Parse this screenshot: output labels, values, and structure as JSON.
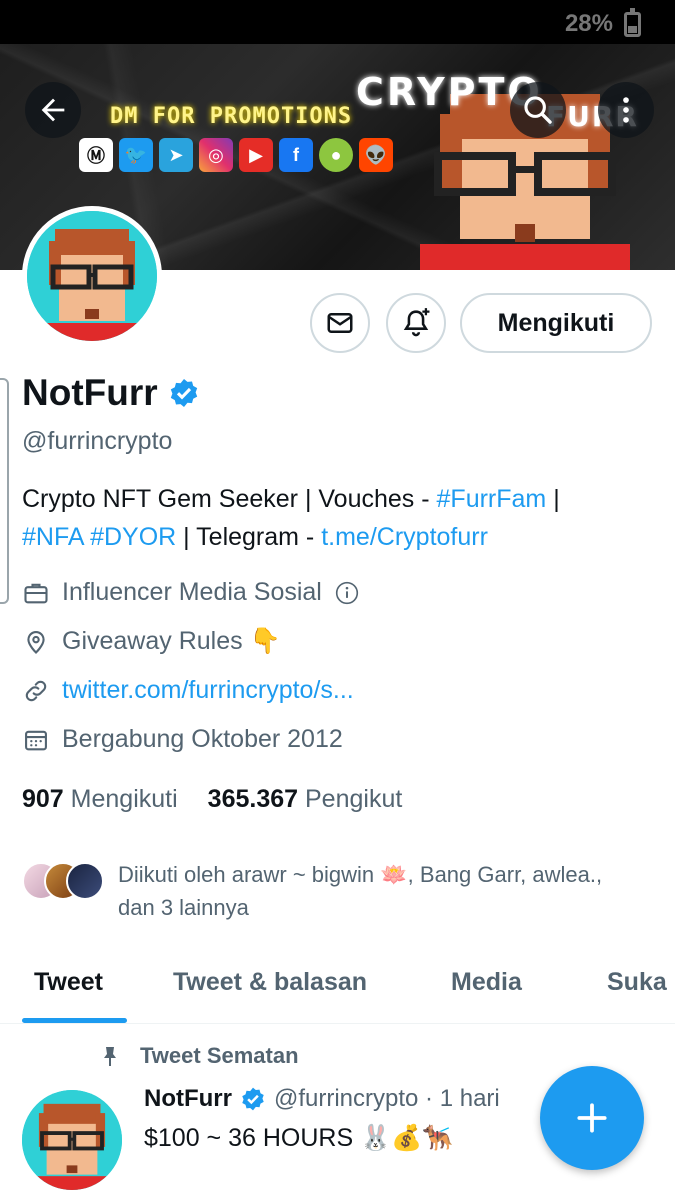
{
  "status_bar": {
    "battery": "28%"
  },
  "banner": {
    "brand_line1": "CRYPTO",
    "brand_line2": "FURR",
    "promo": "DM FOR PROMOTIONS",
    "social_icons": [
      "coinmarketcap-icon",
      "twitter-icon",
      "telegram-icon",
      "instagram-icon",
      "youtube-icon",
      "facebook-icon",
      "coingecko-icon",
      "reddit-icon"
    ]
  },
  "header_actions": {
    "follow_label": "Mengikuti"
  },
  "profile": {
    "name": "NotFurr",
    "handle": "@furrincrypto",
    "bio_plain1": "Crypto NFT Gem Seeker | Vouches - ",
    "bio_tag1": "#FurrFam",
    "bio_plain2": " |",
    "bio_tags2": "#NFA #DYOR",
    "bio_plain3": " | Telegram - ",
    "bio_link": "t.me/Cryptofurr",
    "category": "Influencer Media Sosial",
    "location": "Giveaway Rules 👇",
    "website": "twitter.com/furrincrypto/s...",
    "joined": "Bergabung Oktober 2012"
  },
  "stats": {
    "following_count": "907",
    "following_label": "Mengikuti",
    "followers_count": "365.367",
    "followers_label": "Pengikut"
  },
  "followed_by": "Diikuti oleh arawr ~ bigwin 🪷, Bang Garr, awlea., dan 3 lainnya",
  "tabs": [
    "Tweet",
    "Tweet & balasan",
    "Media",
    "Suka"
  ],
  "pinned": {
    "label": "Tweet Sematan",
    "author": "NotFurr",
    "handle_time": "@furrincrypto · 1 hari",
    "text": "$100 ~ 36 HOURS 🐰💰🐕‍🦺"
  },
  "colors": {
    "accent": "#1d9bf0",
    "text": "#0f1419",
    "secondary": "#536471"
  }
}
